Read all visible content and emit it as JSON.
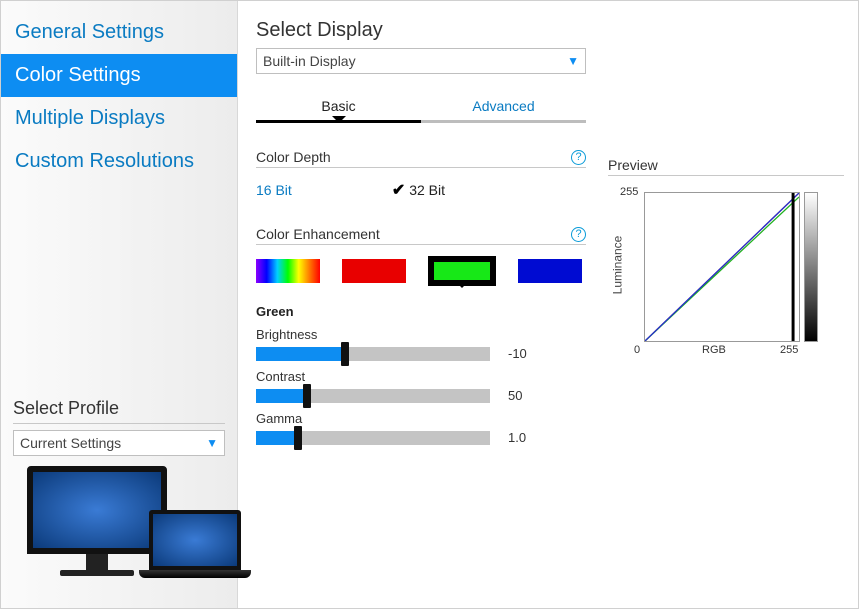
{
  "sidebar": {
    "items": [
      {
        "label": "General Settings",
        "active": false
      },
      {
        "label": "Color Settings",
        "active": true
      },
      {
        "label": "Multiple Displays",
        "active": false
      },
      {
        "label": "Custom Resolutions",
        "active": false
      }
    ],
    "profile": {
      "title": "Select Profile",
      "value": "Current Settings"
    }
  },
  "main": {
    "title": "Select Display",
    "display_value": "Built-in Display",
    "tabs": {
      "basic": "Basic",
      "advanced": "Advanced"
    },
    "color_depth": {
      "title": "Color Depth",
      "opt16": "16 Bit",
      "opt32": "32 Bit",
      "selected": "32 Bit"
    },
    "enhancement": {
      "title": "Color Enhancement",
      "channel": "Green",
      "brightness": {
        "label": "Brightness",
        "value": "-10",
        "percent": 38
      },
      "contrast": {
        "label": "Contrast",
        "value": "50",
        "percent": 22
      },
      "gamma": {
        "label": "Gamma",
        "value": "1.0",
        "percent": 18
      }
    },
    "preview": {
      "title": "Preview",
      "y_label": "Luminance",
      "x_label": "RGB",
      "tick_max": "255",
      "tick_min": "0"
    }
  },
  "chart_data": {
    "type": "line",
    "title": "Preview",
    "xlabel": "RGB",
    "ylabel": "Luminance",
    "xlim": [
      0,
      255
    ],
    "ylim": [
      0,
      255
    ],
    "series": [
      {
        "name": "Red",
        "color": "#d02020",
        "values": [
          [
            0,
            0
          ],
          [
            255,
            255
          ]
        ]
      },
      {
        "name": "Green",
        "color": "#20b020",
        "values": [
          [
            0,
            0
          ],
          [
            255,
            248
          ]
        ]
      },
      {
        "name": "Blue",
        "color": "#2030d0",
        "values": [
          [
            0,
            0
          ],
          [
            255,
            255
          ]
        ]
      }
    ]
  }
}
